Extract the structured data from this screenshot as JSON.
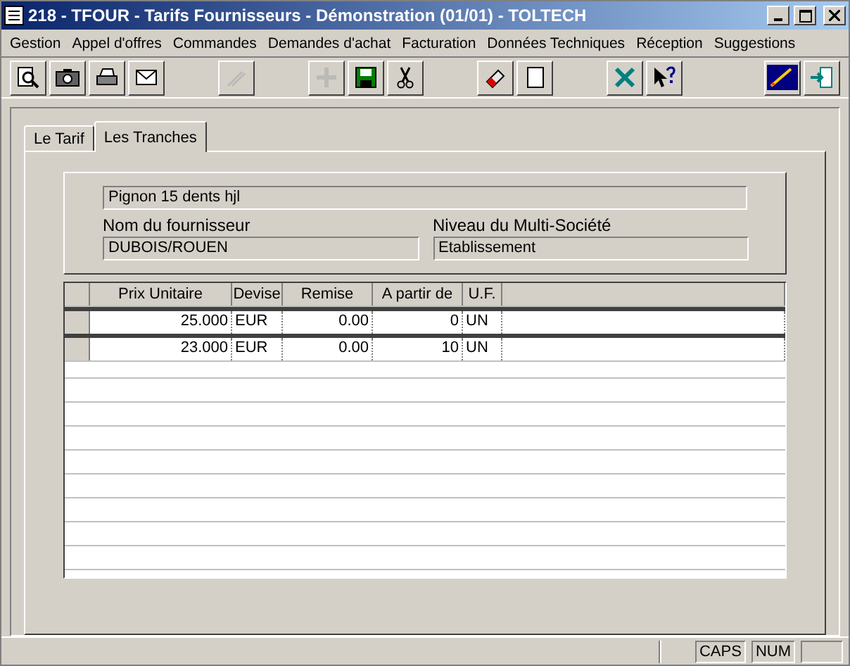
{
  "window": {
    "title": "218 - TFOUR - Tarifs Fournisseurs - Démonstration (01/01) - TOLTECH"
  },
  "menu": [
    {
      "label": "Gestion"
    },
    {
      "label": "Appel d'offres"
    },
    {
      "label": "Commandes"
    },
    {
      "label": "Demandes d'achat"
    },
    {
      "label": "Facturation"
    },
    {
      "label": "Données Techniques"
    },
    {
      "label": "Réception"
    },
    {
      "label": "Suggestions"
    }
  ],
  "toolbar": [
    [
      {
        "kind": "search",
        "disabled": false
      },
      {
        "kind": "camera",
        "disabled": false
      },
      {
        "kind": "printer",
        "disabled": false
      },
      {
        "kind": "mail",
        "disabled": false
      }
    ],
    [
      {
        "kind": "pen",
        "disabled": true
      }
    ],
    [
      {
        "kind": "add",
        "disabled": true
      },
      {
        "kind": "save",
        "disabled": false
      },
      {
        "kind": "cut",
        "disabled": false
      }
    ],
    [
      {
        "kind": "eraser",
        "disabled": false
      },
      {
        "kind": "page",
        "disabled": false
      }
    ],
    [
      {
        "kind": "tools",
        "disabled": false
      },
      {
        "kind": "help",
        "disabled": false
      }
    ],
    [
      {
        "kind": "rocket",
        "disabled": false
      },
      {
        "kind": "exit",
        "disabled": false
      }
    ]
  ],
  "tabs": [
    {
      "label": "Le Tarif",
      "selected": false
    },
    {
      "label": "Les Tranches",
      "selected": true
    }
  ],
  "form": {
    "article": "Pignon 15 dents hjl",
    "supplier": {
      "label": "Nom du fournisseur",
      "value": "DUBOIS/ROUEN"
    },
    "level": {
      "label": "Niveau du Multi-Société",
      "value": "Etablissement"
    }
  },
  "table": {
    "columns": [
      "Prix Unitaire",
      "Devise",
      "Remise",
      "A partir de",
      "U.F."
    ],
    "rows": [
      {
        "cells": [
          "25.000",
          "EUR",
          "0.00",
          "0",
          "UN"
        ],
        "selected": true
      },
      {
        "cells": [
          "23.000",
          "EUR",
          "0.00",
          "10",
          "UN"
        ],
        "selected": false
      }
    ]
  },
  "status_bar": {
    "caps": "CAPS",
    "num": "NUM"
  }
}
